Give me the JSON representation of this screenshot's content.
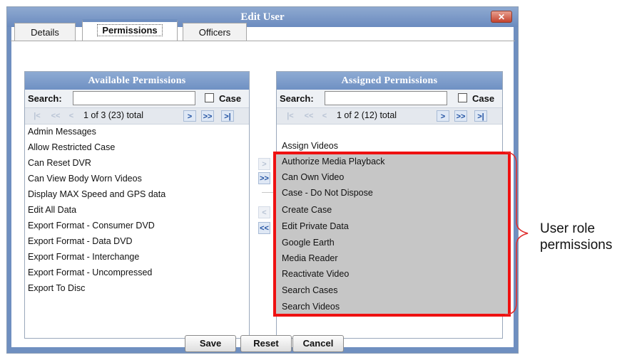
{
  "window": {
    "title": "Edit User",
    "close_icon": "close-icon"
  },
  "tabs": [
    {
      "label": "Details"
    },
    {
      "label": "Permissions"
    },
    {
      "label": "Officers"
    }
  ],
  "available": {
    "header": "Available Permissions",
    "search_label": "Search:",
    "search_value": "",
    "case_label": "Case",
    "pager_info": "1 of 3 (23) total",
    "items": [
      "Admin Messages",
      "Allow Restricted Case",
      "Can Reset DVR",
      "Can View Body Worn Videos",
      "Display MAX Speed and GPS data",
      "Edit All Data",
      "Export Format - Consumer DVD",
      "Export Format - Data DVD",
      "Export Format - Interchange",
      "Export Format - Uncompressed",
      "Export To Disc"
    ]
  },
  "assigned": {
    "header": "Assigned Permissions",
    "search_label": "Search:",
    "search_value": "",
    "case_label": "Case",
    "pager_info": "1 of 2 (12) total",
    "items": [
      "Assign Videos",
      "Authorize Media Playback",
      "Can Own Video",
      "Case - Do Not Dispose",
      "Create Case",
      "Edit Private Data",
      "Google Earth",
      "Media Reader",
      "Reactivate Video",
      "Search Cases",
      "Search Videos"
    ]
  },
  "pager_icons": {
    "first": "|<",
    "prev_page": "<<",
    "prev": "<",
    "next": ">",
    "next_page": ">>",
    "last": ">|"
  },
  "move_buttons": {
    "add": ">",
    "add_all": ">>",
    "remove": "<",
    "remove_all": "<<"
  },
  "buttons": {
    "save": "Save",
    "reset": "Reset",
    "cancel": "Cancel"
  },
  "callout": {
    "line1": "User role",
    "line2": "permissions"
  },
  "colors": {
    "highlight_border": "#ee1111",
    "highlight_fill": "#c6c6c6",
    "header_blue": "#6f8fc0"
  }
}
